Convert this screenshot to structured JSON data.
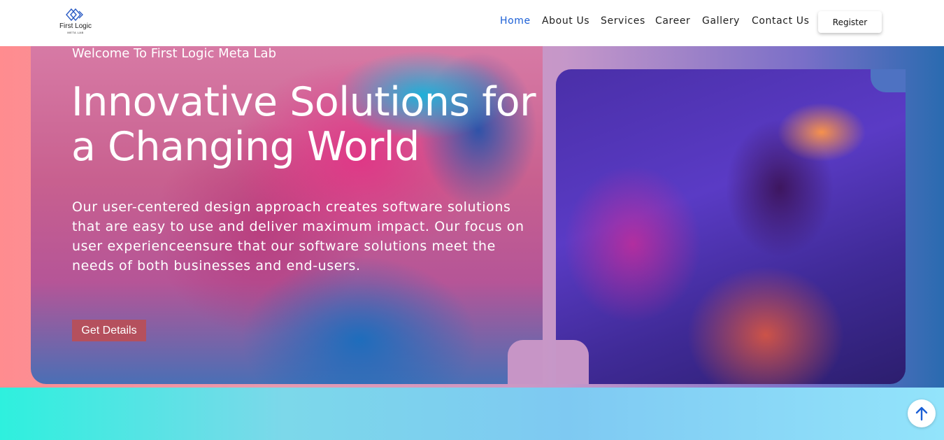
{
  "brand": {
    "name": "First Logic",
    "tagline": "META LAB"
  },
  "nav": {
    "items": [
      "Home",
      "About Us",
      "Services",
      "Career",
      "Gallery",
      "Contact Us"
    ],
    "active": "Home",
    "register_label": "Register"
  },
  "hero": {
    "welcome": "Welcome To First Logic Meta Lab",
    "headline": "Innovative Solutions for a Changing World",
    "description": "Our user-centered design approach creates software solutions that are easy to use and deliver maximum impact. Our focus on user experienceensure that our software solutions meet the needs of both businesses and end-users.",
    "cta_label": "Get Details"
  },
  "icons": {
    "logo": "diamond-logo-icon",
    "scroll_top": "arrow-up-icon"
  },
  "colors": {
    "accent": "#1b5fd6",
    "cta": "#b5505d"
  }
}
